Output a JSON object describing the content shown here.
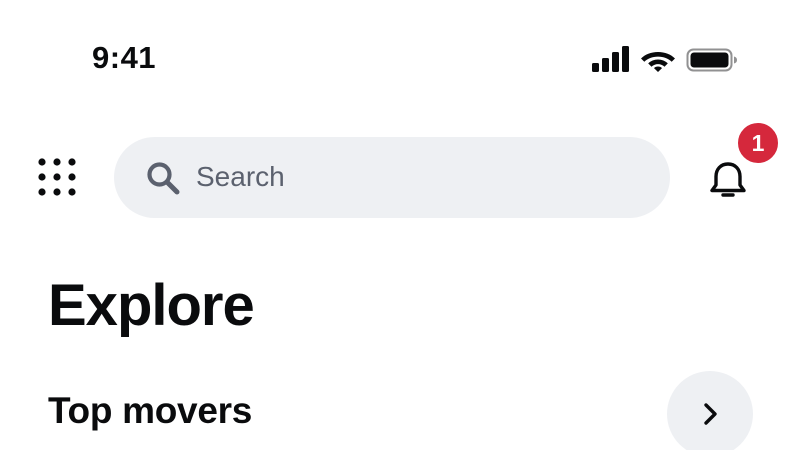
{
  "status_bar": {
    "time": "9:41",
    "icons": [
      "signal-icon",
      "wifi-icon",
      "battery-icon"
    ]
  },
  "header": {
    "menu_icon": "grid-icon",
    "search": {
      "placeholder": "Search",
      "icon": "search-icon"
    },
    "notifications": {
      "icon": "bell-icon",
      "badge_count": "1",
      "badge_color": "#d5283c"
    }
  },
  "main": {
    "title": "Explore",
    "sections": [
      {
        "title": "Top movers",
        "action_icon": "chevron-right-icon"
      }
    ]
  },
  "colors": {
    "background": "#ffffff",
    "text": "#0a0b0d",
    "search_bg": "#eef0f3",
    "placeholder": "#5b616e",
    "badge": "#d5283c"
  }
}
